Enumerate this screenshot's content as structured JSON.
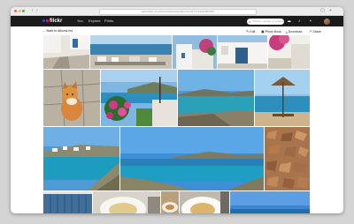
{
  "browser": {
    "url": "www.flickr.com/photos/leifmarks/albums/72177720321800453"
  },
  "nav": {
    "logo": "flickr",
    "links": [
      "You",
      "Explore",
      "Prints"
    ],
    "search_placeholder": "Photos, people, or groups"
  },
  "subbar": {
    "back_label": "Back to albums list",
    "actions": [
      {
        "icon": "pencil-icon",
        "label": "Edit"
      },
      {
        "icon": "book-icon",
        "label": "Photo Book"
      },
      {
        "icon": "download-icon",
        "label": "Download"
      },
      {
        "icon": "share-icon",
        "label": "Share"
      }
    ]
  },
  "photos": [
    {
      "subject": "whitewashed courtyard with cobblestone path"
    },
    {
      "subject": "harbor with moored boats"
    },
    {
      "subject": "white cycladic houses with pink bougainvillea"
    },
    {
      "subject": "white chapel doorway with blue door"
    },
    {
      "subject": "stone steps with pink bougainvillea"
    },
    {
      "subject": "orange cat sitting on paving stones"
    },
    {
      "subject": "pink flowers with bay and lamp post"
    },
    {
      "subject": "turquoise bay with rocky coast"
    },
    {
      "subject": "beach umbrella by the sea"
    },
    {
      "subject": "coastal village and turquoise bay"
    },
    {
      "subject": "wide turquoise sea and islands"
    },
    {
      "subject": "broken pottery shards"
    },
    {
      "subject": "blue wooden shutters"
    },
    {
      "subject": "pasta dish on a plate"
    },
    {
      "subject": "table with food"
    },
    {
      "subject": "pasta on white plate"
    },
    {
      "subject": "sea horizon under blue sky"
    }
  ]
}
